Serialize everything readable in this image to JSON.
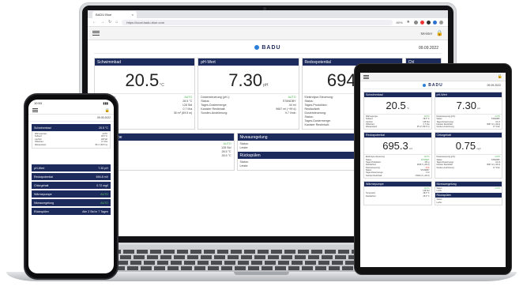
{
  "browser": {
    "tab_title": "BADU Blue",
    "url": "https://local.badu-blue.com",
    "zoom": "80%"
  },
  "app": {
    "logo": "BADU",
    "user": "Meister",
    "date": "09.09.2022"
  },
  "cards": [
    {
      "title": "Schwimmbad",
      "value": "20.5",
      "unit": "°C",
      "rows": [
        {
          "k": "Wärmepumpe:",
          "v": "AUTO",
          "c": "g"
        },
        {
          "k": "Sollwert:",
          "v": "28.5 °C"
        },
        {
          "k": "Laufzeit:",
          "v": "128 Std"
        },
        {
          "k": "Hilfsmittel:",
          "v": "0.7 l/ha"
        },
        {
          "k": "Wasserstand:",
          "v": "35 m³ (69.5 m)"
        }
      ]
    },
    {
      "title": "pH-Wert",
      "value": "7.30",
      "unit": "pH",
      "rows": [
        {
          "k": "Dosiersteuerung (pH-):",
          "v": "AUTO",
          "c": "g"
        },
        {
          "k": "Status:",
          "v": "STANDBY"
        },
        {
          "k": "Tages-Dosiermenge:",
          "v": "44 ml"
        },
        {
          "k": "Kanister Restinhalt:",
          "v": "9667 ml (~99 d)"
        },
        {
          "k": "Sonden-Anströmung:",
          "v": "9.7 l/min"
        }
      ]
    },
    {
      "title": "Redoxpotential",
      "value": "694.5",
      "unit": "mV",
      "rows": [
        {
          "k": "Elektrolyse-Steuerung:",
          "v": "AUTO",
          "c": "g"
        },
        {
          "k": "Status:",
          "v": "DOSIERT",
          "c": "g"
        },
        {
          "k": "Tages-Produktion:",
          "v": "254 g"
        },
        {
          "k": "Restlaufzeit:",
          "v": "2639 h (~99 d)"
        },
        {
          "k": "",
          "v": ""
        },
        {
          "k": "Dosiersteuerung:",
          "v": "AUS",
          "c": "rd"
        },
        {
          "k": "Status:",
          "v": "STANDBY"
        },
        {
          "k": "Tages-Dosiermenge:",
          "v": "0 ml"
        },
        {
          "k": "Kanister Restinhalt:",
          "v": "17364 ml (~99 d)"
        }
      ]
    },
    {
      "title": "Chl",
      "value": "",
      "unit": "",
      "rows": [
        {
          "k": "Dosi",
          "v": ""
        }
      ]
    }
  ],
  "lower": [
    {
      "title": "Wärmepumpe",
      "rows": [
        {
          "k": "",
          "v": "AUTO",
          "c": "g"
        },
        {
          "k": "",
          "v": "128 Std"
        },
        {
          "k": "Temperatur",
          "v": "28.5 °C"
        },
        {
          "k": "Restlaufzeit",
          "v": "28.5 °C"
        }
      ]
    },
    {
      "title": "Niveauregelung",
      "rows": [
        {
          "k": "Status:",
          "v": "AUTO",
          "c": "g"
        },
        {
          "k": "Letzte:",
          "v": ""
        }
      ],
      "title2": "Rückspülen",
      "rows2": [
        {
          "k": "Status:",
          "v": ""
        },
        {
          "k": "Letzte:",
          "v": ""
        }
      ]
    }
  ],
  "tablet": {
    "cards": [
      {
        "title": "Schwimmbad",
        "value": "20.5",
        "unit": "°C"
      },
      {
        "title": "pH-Wert",
        "value": "7.30",
        "unit": "pH"
      },
      {
        "title": "Redoxpotential",
        "value": "695.3",
        "unit": "mV"
      },
      {
        "title": "Chlorgehalt",
        "value": "0.75",
        "unit": "mg/l"
      },
      {
        "title": "Wärmepumpe",
        "value": "",
        "unit": ""
      },
      {
        "title": "Niveauregelung",
        "value": "",
        "unit": ""
      }
    ],
    "sub_title": "Rückspülen"
  },
  "phone": {
    "time": "10:53",
    "date": "09.09.2022",
    "pool": {
      "title": "Schwimmbad",
      "value": "20.5 °C"
    },
    "pool_rows": [
      {
        "k": "Wärmepumpe:",
        "v": "AUTO"
      },
      {
        "k": "Sollwert:",
        "v": "28.5 °C"
      },
      {
        "k": "Laufzeit:",
        "v": "128 Std"
      },
      {
        "k": "Hilfsmittel:",
        "v": "0.7 l/ha"
      },
      {
        "k": "Wasserstand:",
        "v": "35 m³ (69.5 m)"
      }
    ],
    "bars": [
      {
        "title": "pH-Wert",
        "value": "7.30 pH"
      },
      {
        "title": "Redoxpotential",
        "value": "694.8 mV"
      },
      {
        "title": "Chlorgehalt",
        "value": "0.72 mg/l"
      },
      {
        "title": "Wärmepumpe",
        "value": "AUTO"
      },
      {
        "title": "Niveauregelung",
        "value": "AUTO"
      },
      {
        "title": "Rückspülen",
        "value": "Alle 3 Std in 7 Tagen"
      }
    ]
  }
}
